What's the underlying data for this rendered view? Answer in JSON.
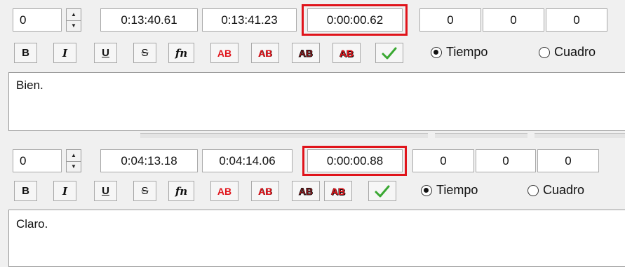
{
  "colors": {
    "highlight": "#e0141b",
    "check": "#3aa832"
  },
  "panels": [
    {
      "layer": "0",
      "start": "0:13:40.61",
      "end": "0:13:41.23",
      "duration": "0:00:00.62",
      "margin_l": "0",
      "margin_r": "0",
      "margin_v": "0",
      "toolbar": {
        "bold": "B",
        "italic": "I",
        "underline": "U",
        "strike": "S",
        "fn": "fn",
        "ab": "AB"
      },
      "radio_time": "Tiempo",
      "radio_frame": "Cuadro",
      "text": "Bien."
    },
    {
      "layer": "0",
      "start": "0:04:13.18",
      "end": "0:04:14.06",
      "duration": "0:00:00.88",
      "margin_l": "0",
      "margin_r": "0",
      "margin_v": "0",
      "toolbar": {
        "bold": "B",
        "italic": "I",
        "underline": "U",
        "strike": "S",
        "fn": "fn",
        "ab": "AB"
      },
      "radio_time": "Tiempo",
      "radio_frame": "Cuadro",
      "text": "Claro."
    }
  ]
}
